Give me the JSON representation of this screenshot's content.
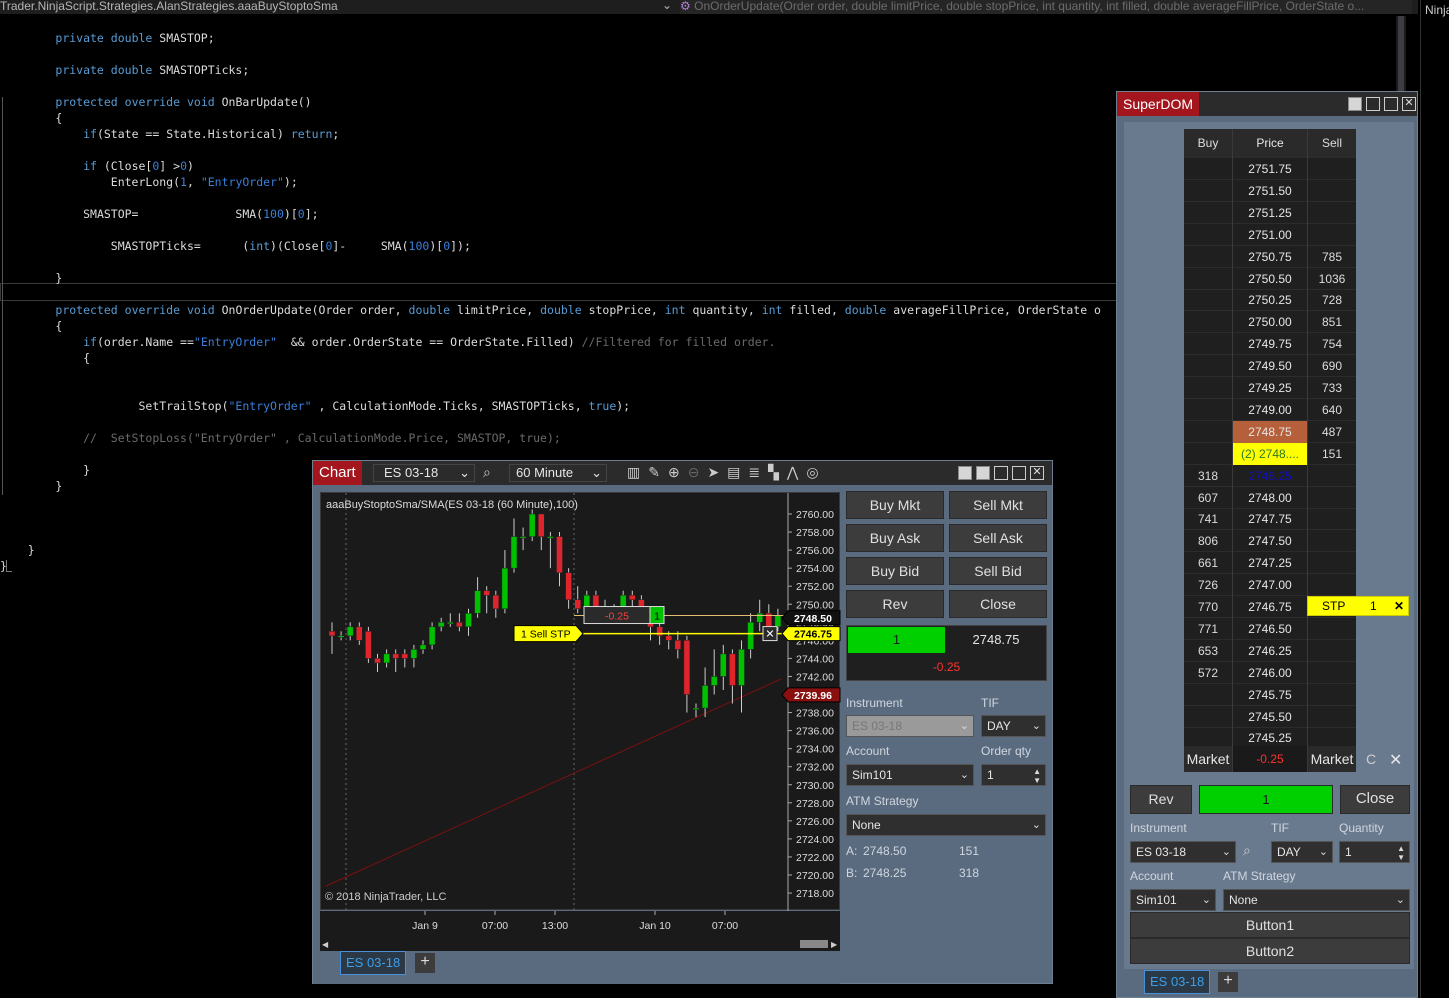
{
  "editor": {
    "type_dropdown": "Trader.NinjaScript.Strategies.AlanStrategies.aaaBuyStoptoSma",
    "member_dropdown": "OnOrderUpdate(Order order, double limitPrice, double stopPrice, int quantity, int filled, double averageFillPrice, OrderState o...",
    "right_label": "Ninja",
    "lines": [
      {
        "indent": "        ",
        "html": "<span class=\"kw\">private</span> <span class=\"kw\">double</span> SMASTOP;",
        "row": 0
      },
      {
        "indent": "        ",
        "html": "<span class=\"kw\">private</span> <span class=\"kw\">double</span> SMASTOPTicks;",
        "row": 2
      },
      {
        "indent": "        ",
        "html": "<span class=\"kw\">protected</span> <span class=\"kw\">override</span> <span class=\"kw\">void</span> OnBarUpdate()",
        "row": 4
      },
      {
        "indent": "        ",
        "html": "{",
        "row": 5
      },
      {
        "indent": "            ",
        "html": "<span class=\"kw\">if</span>(State == State.Historical) <span class=\"kw\">return</span>;",
        "row": 6
      },
      {
        "indent": "            ",
        "html": "<span class=\"kw\">if</span> (Close[<span class=\"st\">0</span>] &gt;<span class=\"st\">0</span>)",
        "row": 8
      },
      {
        "indent": "                ",
        "html": "EnterLong(<span class=\"st\">1</span>, <span class=\"st\">\"EntryOrder\"</span>);",
        "row": 9
      },
      {
        "indent": "            ",
        "html": "SMASTOP=              SMA(<span class=\"st\">100</span>)[<span class=\"st\">0</span>];",
        "row": 11
      },
      {
        "indent": "                ",
        "html": "SMASTOPTicks=      (<span class=\"kw\">int</span>)(Close[<span class=\"st\">0</span>]-     SMA(<span class=\"st\">100</span>)[<span class=\"st\">0</span>]);",
        "row": 13
      },
      {
        "indent": "        ",
        "html": "}",
        "row": 15
      },
      {
        "indent": "        ",
        "html": "<span class=\"kw\">protected</span> <span class=\"kw\">override</span> <span class=\"kw\">void</span> OnOrderUpdate(Order order, <span class=\"kw\">double</span> limitPrice, <span class=\"kw\">double</span> stopPrice, <span class=\"kw\">int</span> quantity, <span class=\"kw\">int</span> filled, <span class=\"kw\">double</span> averageFillPrice, OrderState o",
        "row": 17
      },
      {
        "indent": "        ",
        "html": "{",
        "row": 18
      },
      {
        "indent": "            ",
        "html": "<span class=\"kw\">if</span>(order.Name ==<span class=\"st\">\"EntryOrder\"</span>  &amp;&amp; order.OrderState == OrderState.Filled) <span class=\"cm\">//Filtered for filled order.</span>",
        "row": 19
      },
      {
        "indent": "            ",
        "html": "{",
        "row": 20
      },
      {
        "indent": "                    ",
        "html": "SetTrailStop(<span class=\"st\">\"EntryOrder\"</span> , CalculationMode.Ticks, SMASTOPTicks, <span class=\"kw\">true</span>);",
        "row": 23
      },
      {
        "indent": "            ",
        "html": "<span class=\"cm\">//  SetStopLoss(\"EntryOrder\" , CalculationMode.Price, SMASTOP, true);</span>",
        "row": 25
      },
      {
        "indent": "            ",
        "html": "}",
        "row": 27
      },
      {
        "indent": "        ",
        "html": "}",
        "row": 28
      },
      {
        "indent": "    ",
        "html": "}",
        "row": 32
      },
      {
        "indent": "",
        "html": "}",
        "row": 33
      }
    ]
  },
  "chart": {
    "tab": "Chart",
    "instrument": "ES 03-18",
    "interval": "60 Minute",
    "title": "aaaBuyStoptoSma/SMA(ES 03-18 (60 Minute),100)",
    "copyright": "© 2018 NinjaTrader, LLC",
    "sheet_tab": "ES 03-18",
    "add_tab": "+",
    "price_labels": [
      "2760.00",
      "2758.00",
      "2756.00",
      "2754.00",
      "2752.00",
      "2750.00",
      "2748.00",
      "2746.00",
      "2744.00",
      "2742.00",
      "2740.00",
      "2738.00",
      "2736.00",
      "2734.00",
      "2732.00",
      "2730.00",
      "2728.00",
      "2726.00",
      "2724.00",
      "2722.00",
      "2720.00",
      "2718.00"
    ],
    "time_labels": [
      "Jan 9",
      "07:00",
      "13:00",
      "Jan 10",
      "07:00"
    ],
    "marker_last": "2748.50",
    "marker_stop": "2746.75",
    "marker_sma": "2739.96",
    "position_pnl": "-0.25",
    "position_qty": "1",
    "stop_order_label": "1  Sell STP",
    "stop_cancel": "✕"
  },
  "chart_trader": {
    "buy_mkt": "Buy Mkt",
    "sell_mkt": "Sell Mkt",
    "buy_ask": "Buy Ask",
    "sell_ask": "Sell Ask",
    "buy_bid": "Buy Bid",
    "sell_bid": "Sell Bid",
    "rev": "Rev",
    "close": "Close",
    "pos_qty": "1",
    "pos_price": "2748.75",
    "pnl": "-0.25",
    "instrument_label": "Instrument",
    "instrument": "ES 03-18",
    "tif_label": "TIF",
    "tif": "DAY",
    "account_label": "Account",
    "account": "Sim101",
    "orderqty_label": "Order qty",
    "orderqty": "1",
    "atm_label": "ATM Strategy",
    "atm": "None",
    "ask_label": "A:",
    "ask_price": "2748.50",
    "ask_size": "151",
    "bid_label": "B:",
    "bid_price": "2748.25",
    "bid_size": "318"
  },
  "superdom": {
    "title": "SuperDOM",
    "col_buy": "Buy",
    "col_price": "Price",
    "col_sell": "Sell",
    "rows": [
      {
        "b": "",
        "p": "2751.75",
        "s": ""
      },
      {
        "b": "",
        "p": "2751.50",
        "s": ""
      },
      {
        "b": "",
        "p": "2751.25",
        "s": ""
      },
      {
        "b": "",
        "p": "2751.00",
        "s": ""
      },
      {
        "b": "",
        "p": "2750.75",
        "s": "785"
      },
      {
        "b": "",
        "p": "2750.50",
        "s": "1036"
      },
      {
        "b": "",
        "p": "2750.25",
        "s": "728"
      },
      {
        "b": "",
        "p": "2750.00",
        "s": "851"
      },
      {
        "b": "",
        "p": "2749.75",
        "s": "754"
      },
      {
        "b": "",
        "p": "2749.50",
        "s": "690"
      },
      {
        "b": "",
        "p": "2749.25",
        "s": "733"
      },
      {
        "b": "",
        "p": "2749.00",
        "s": "640"
      },
      {
        "b": "",
        "p": "2748.75",
        "s": "487"
      },
      {
        "b": "",
        "p": "(2) 2748....",
        "s": "151"
      },
      {
        "b": "318",
        "p": "2748.25",
        "s": ""
      },
      {
        "b": "607",
        "p": "2748.00",
        "s": ""
      },
      {
        "b": "741",
        "p": "2747.75",
        "s": ""
      },
      {
        "b": "806",
        "p": "2747.50",
        "s": ""
      },
      {
        "b": "661",
        "p": "2747.25",
        "s": ""
      },
      {
        "b": "726",
        "p": "2747.00",
        "s": ""
      },
      {
        "b": "770",
        "p": "2746.75",
        "s": ""
      },
      {
        "b": "771",
        "p": "2746.50",
        "s": ""
      },
      {
        "b": "653",
        "p": "2746.25",
        "s": ""
      },
      {
        "b": "572",
        "p": "2746.00",
        "s": ""
      },
      {
        "b": "",
        "p": "2745.75",
        "s": ""
      },
      {
        "b": "",
        "p": "2745.50",
        "s": ""
      },
      {
        "b": "",
        "p": "2745.25",
        "s": ""
      }
    ],
    "market_buy": "Market",
    "pnl": "-0.25",
    "market_sell": "Market",
    "c_label": "C",
    "x_label": "✕",
    "stp_label": "STP",
    "stp_qty": "1",
    "stp_x": "✕",
    "rev": "Rev",
    "pos_qty": "1",
    "close": "Close",
    "instrument_label": "Instrument",
    "instrument": "ES 03-18",
    "tif_label": "TIF",
    "tif": "DAY",
    "quantity_label": "Quantity",
    "quantity": "1",
    "account_label": "Account",
    "account": "Sim101",
    "atm_label": "ATM Strategy",
    "atm": "None",
    "button1": "Button1",
    "button2": "Button2",
    "sheet_tab": "ES 03-18",
    "add_tab": "+"
  },
  "colors": {
    "buy_green": "#00d000",
    "sell_red": "#e0242c",
    "stop_yellow": "#ffff00",
    "accent_blue": "#3d9ee8"
  }
}
